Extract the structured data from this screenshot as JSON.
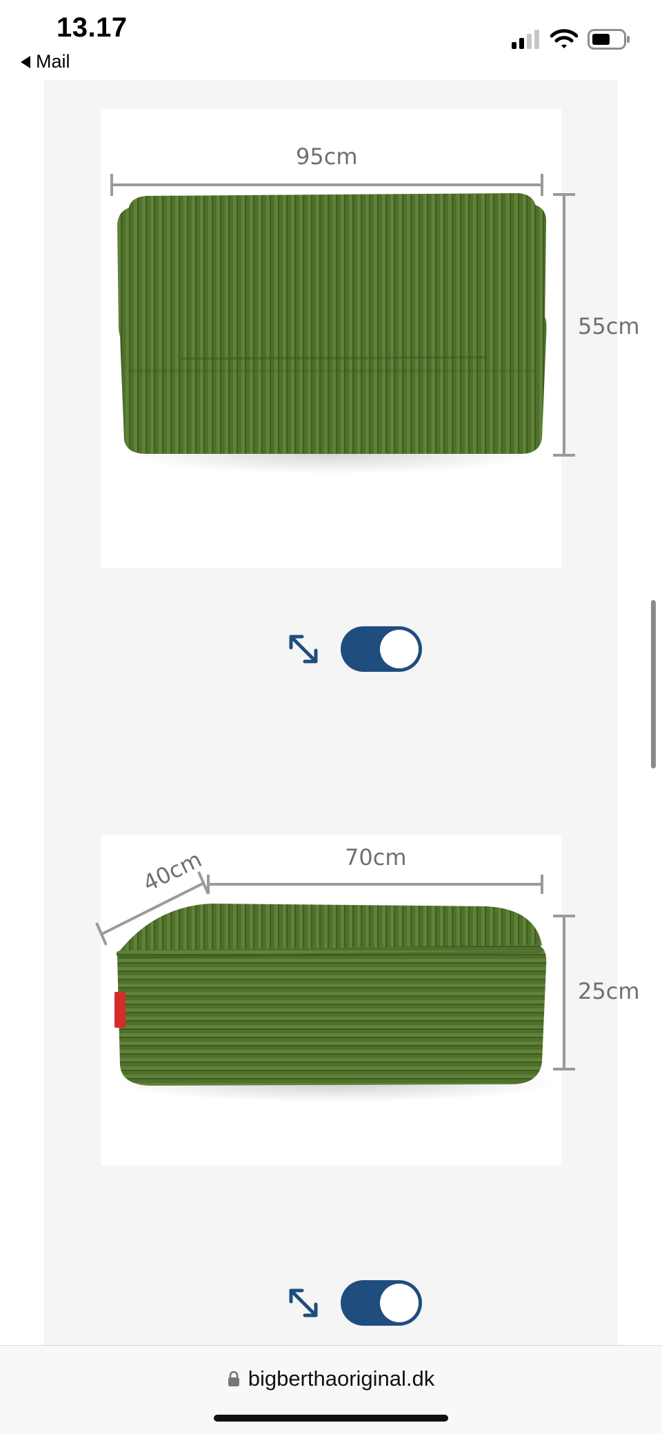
{
  "status_bar": {
    "time": "13.17",
    "back_label": "Mail",
    "icons": [
      "signal-icon",
      "wifi-icon",
      "battery-icon"
    ]
  },
  "products": [
    {
      "name": "sofa",
      "colors": {
        "fabric": "#4f6f2c"
      },
      "dimensions": {
        "width": "95cm",
        "height": "55cm"
      }
    },
    {
      "name": "footstool",
      "colors": {
        "fabric": "#4f6f2c"
      },
      "dimensions": {
        "width": "70cm",
        "depth": "40cm",
        "height": "25cm"
      }
    }
  ],
  "toggles": [
    {
      "state": "on",
      "color": "#1f4d7d"
    },
    {
      "state": "on",
      "color": "#1f4d7d"
    }
  ],
  "browser": {
    "url": "bigberthaoriginal.dk"
  }
}
